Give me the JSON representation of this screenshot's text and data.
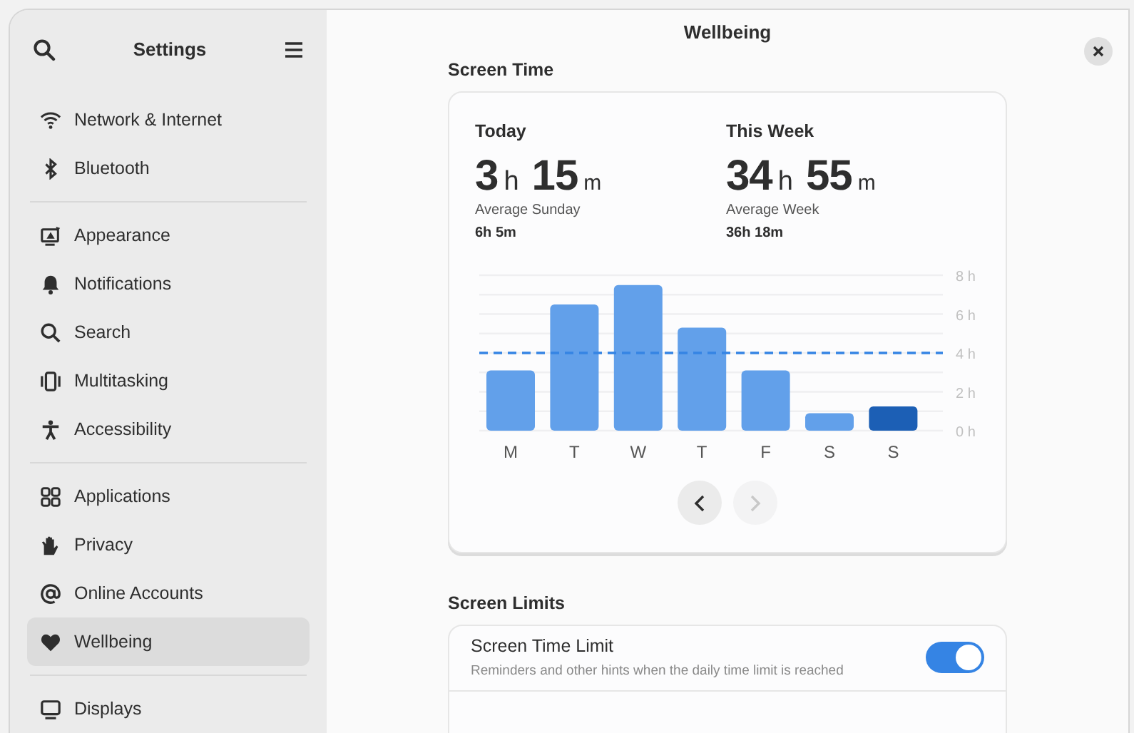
{
  "sidebar": {
    "title": "Settings",
    "groups": [
      [
        {
          "label": "Network & Internet",
          "selected": false
        },
        {
          "label": "Bluetooth",
          "selected": false
        }
      ],
      [
        {
          "label": "Appearance",
          "selected": false
        },
        {
          "label": "Notifications",
          "selected": false
        },
        {
          "label": "Search",
          "selected": false
        },
        {
          "label": "Multitasking",
          "selected": false
        },
        {
          "label": "Accessibility",
          "selected": false
        }
      ],
      [
        {
          "label": "Applications",
          "selected": false
        },
        {
          "label": "Privacy",
          "selected": false
        },
        {
          "label": "Online Accounts",
          "selected": false
        },
        {
          "label": "Wellbeing",
          "selected": true
        }
      ],
      [
        {
          "label": "Displays",
          "selected": false
        }
      ]
    ]
  },
  "main": {
    "title": "Wellbeing",
    "screen_time": {
      "heading": "Screen Time",
      "stats": [
        {
          "label": "Today",
          "hours": "3",
          "hours_unit": "h",
          "minutes": "15",
          "minutes_unit": "m",
          "average_label": "Average Sunday",
          "average": "6h 5m"
        },
        {
          "label": "This Week",
          "hours": "34",
          "hours_unit": "h",
          "minutes": "55",
          "minutes_unit": "m",
          "average_label": "Average Week",
          "average": "36h 18m"
        }
      ],
      "chart_data": {
        "type": "bar",
        "categories": [
          "M",
          "T",
          "W",
          "T",
          "F",
          "S",
          "S"
        ],
        "stacked": true,
        "series": [
          {
            "color": "#62a0ea",
            "values": [
              3.1,
              6.5,
              7.5,
              5.3,
              3.1,
              0.9,
              null
            ]
          },
          {
            "color": "#1c5fb5",
            "values": [
              null,
              null,
              null,
              null,
              null,
              null,
              1.25
            ]
          }
        ],
        "grid": true,
        "ylim": [
          0,
          8
        ],
        "yticks": [
          {
            "value": 0,
            "label": "0 h"
          },
          {
            "value": 2,
            "label": "2 h"
          },
          {
            "value": 4,
            "label": "4 h"
          },
          {
            "value": 6,
            "label": "6 h"
          },
          {
            "value": 8,
            "label": "8 h"
          }
        ],
        "ref_lines": [
          {
            "axis": "y",
            "value": 4,
            "color": "#3584e4"
          }
        ]
      },
      "nav": [
        {
          "kind": "previous",
          "disabled": false
        },
        {
          "kind": "next",
          "disabled": true
        }
      ]
    },
    "screen_limits": {
      "heading": "Screen Limits",
      "rows": [
        {
          "title": "Screen Time Limit",
          "subtitle": "Reminders and other hints when the daily time limit is reached",
          "on": true
        }
      ]
    }
  }
}
